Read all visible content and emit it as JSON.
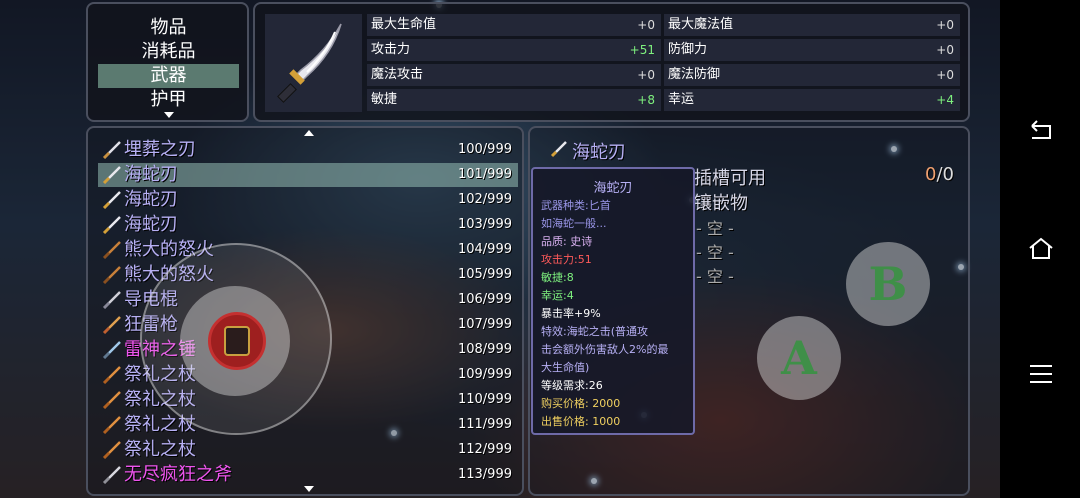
{
  "categories": {
    "items": [
      "物品",
      "消耗品",
      "武器",
      "护甲"
    ],
    "active_index": 2
  },
  "stats": {
    "left": [
      {
        "name": "最大生命值",
        "value": "+0",
        "color": "#dddddd"
      },
      {
        "name": "攻击力",
        "value": "+51",
        "color": "#7ef07e"
      },
      {
        "name": "魔法攻击",
        "value": "+0",
        "color": "#dddddd"
      },
      {
        "name": "敏捷",
        "value": "+8",
        "color": "#7ef07e"
      }
    ],
    "right": [
      {
        "name": "最大魔法值",
        "value": "+0",
        "color": "#dddddd"
      },
      {
        "name": "防御力",
        "value": "+0",
        "color": "#dddddd"
      },
      {
        "name": "魔法防御",
        "value": "+0",
        "color": "#dddddd"
      },
      {
        "name": "幸运",
        "value": "+4",
        "color": "#7ef07e"
      }
    ]
  },
  "inventory": {
    "selected_index": 1,
    "items": [
      {
        "name": "埋葬之刃",
        "count": "100/999",
        "icon": "blade-icon",
        "color": "#b7b0f5"
      },
      {
        "name": "海蛇刃",
        "count": "101/999",
        "icon": "sea-serpent-blade-icon",
        "color": "#b7b0f5"
      },
      {
        "name": "海蛇刃",
        "count": "102/999",
        "icon": "sea-serpent-blade-icon",
        "color": "#b7b0f5"
      },
      {
        "name": "海蛇刃",
        "count": "103/999",
        "icon": "sea-serpent-blade-icon",
        "color": "#b7b0f5"
      },
      {
        "name": "熊大的怒火",
        "count": "104/999",
        "icon": "claw-icon",
        "color": "#b7b0f5"
      },
      {
        "name": "熊大的怒火",
        "count": "105/999",
        "icon": "claw-icon",
        "color": "#b7b0f5"
      },
      {
        "name": "导电棍",
        "count": "106/999",
        "icon": "rod-icon",
        "color": "#b7b0f5"
      },
      {
        "name": "狂雷枪",
        "count": "107/999",
        "icon": "spear-icon",
        "color": "#b7b0f5"
      },
      {
        "name": "雷神之锤",
        "count": "108/999",
        "icon": "hammer-icon",
        "color": "#ee55ee"
      },
      {
        "name": "祭礼之杖",
        "count": "109/999",
        "icon": "staff-icon",
        "color": "#b7b0f5"
      },
      {
        "name": "祭礼之杖",
        "count": "110/999",
        "icon": "staff-icon",
        "color": "#b7b0f5"
      },
      {
        "name": "祭礼之杖",
        "count": "111/999",
        "icon": "staff-icon",
        "color": "#b7b0f5"
      },
      {
        "name": "祭礼之杖",
        "count": "112/999",
        "icon": "staff-icon",
        "color": "#b7b0f5"
      },
      {
        "name": "无尽疯狂之斧",
        "count": "113/999",
        "icon": "axe-icon",
        "color": "#ee55ee"
      }
    ]
  },
  "detail": {
    "title": "海蛇刃",
    "slot_label": "插槽可用",
    "gem_label": "镶嵌物",
    "slot_count_used": "0",
    "slot_count_total": "/0",
    "empty_slots": [
      "- 空 -",
      "- 空 -",
      "- 空 -"
    ]
  },
  "tooltip": {
    "title": "海蛇刃",
    "lines": [
      {
        "text": "武器种类:匕首",
        "color": "#9a96e8"
      },
      {
        "text": "如海蛇一般...",
        "color": "#9a96e8"
      },
      {
        "text": "品质: 史诗",
        "color": "#d8b0f0"
      },
      {
        "text": "攻击力:51",
        "color": "#ff5a5a"
      },
      {
        "text": "敏捷:8",
        "color": "#7ef07e"
      },
      {
        "text": "幸运:4",
        "color": "#7ef07e"
      },
      {
        "text": "暴击率+9%",
        "color": "#ffffff"
      },
      {
        "text": "特效:海蛇之击(普通攻",
        "color": "#b7b0f5"
      },
      {
        "text": "击会额外伤害敌人2%的最",
        "color": "#b7b0f5"
      },
      {
        "text": "大生命值)",
        "color": "#b7b0f5"
      },
      {
        "text": "等级需求:26",
        "color": "#ffffff"
      },
      {
        "text": "购买价格: 2000",
        "color": "#f0d060"
      },
      {
        "text": "出售价格: 1000",
        "color": "#f0d060"
      }
    ]
  },
  "controls": {
    "b_label": "B",
    "a_label": "A"
  }
}
